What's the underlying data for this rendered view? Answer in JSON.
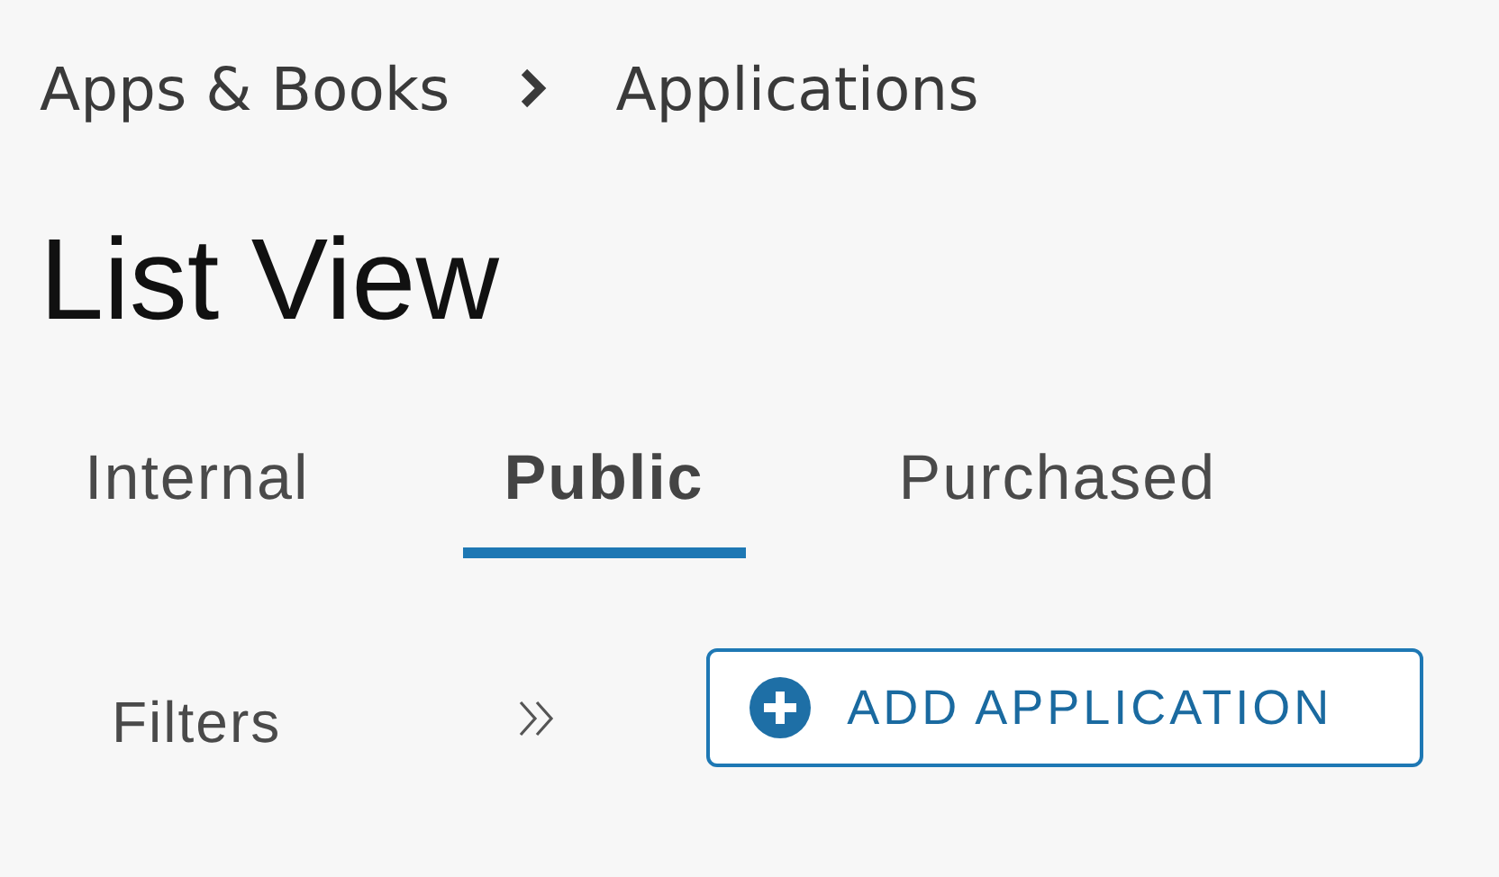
{
  "breadcrumb": [
    "Apps & Books",
    "Applications"
  ],
  "title": "List View",
  "tabs": [
    {
      "label": "Internal",
      "selected": false
    },
    {
      "label": "Public",
      "selected": true
    },
    {
      "label": "Purchased",
      "selected": false
    }
  ],
  "toolbar": {
    "filters_label": "Filters",
    "add_button": "ADD APPLICATION"
  }
}
